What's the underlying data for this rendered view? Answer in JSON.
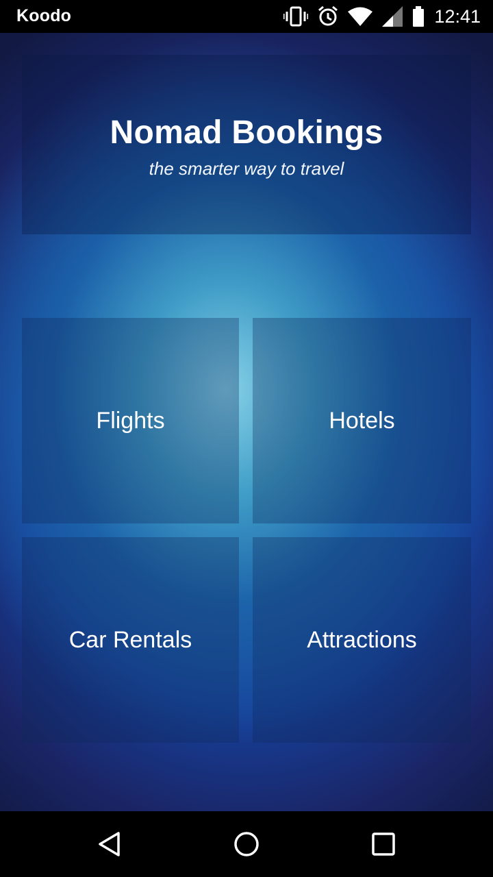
{
  "status_bar": {
    "carrier": "Koodo",
    "time": "12:41",
    "icons": [
      "vibrate-icon",
      "alarm-icon",
      "wifi-icon",
      "signal-icon",
      "battery-icon"
    ]
  },
  "header": {
    "title": "Nomad Bookings",
    "tagline": "the smarter way to travel"
  },
  "tiles": [
    {
      "label": "Flights"
    },
    {
      "label": "Hotels"
    },
    {
      "label": "Car Rentals"
    },
    {
      "label": "Attractions"
    }
  ],
  "nav_bar": {
    "icons": [
      "back-icon",
      "home-icon",
      "recents-icon"
    ]
  },
  "colors": {
    "status_bar_bg": "#000000",
    "nav_bar_bg": "#000000",
    "text": "#ffffff",
    "background_center": "#8cd7eb",
    "background_edge": "#16409a"
  }
}
